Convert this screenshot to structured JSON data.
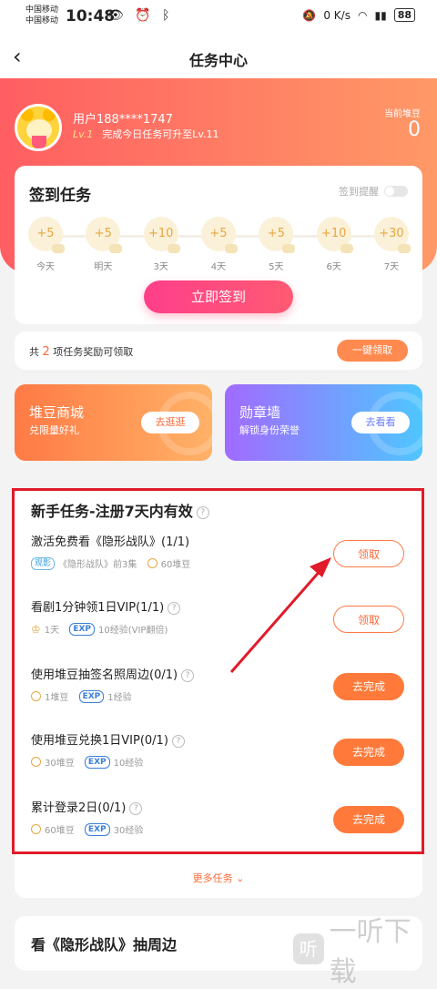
{
  "status": {
    "carrier1": "中国移动",
    "carrier2": "中国移动",
    "time": "10:48",
    "net": "0 K/s",
    "battery": "88"
  },
  "nav": {
    "title": "任务中心"
  },
  "user": {
    "name": "用户188****1747",
    "level": "Lv.1",
    "upgrade": "完成今日任务可升至Lv.11",
    "balance_label": "当前堆豆",
    "balance": "0"
  },
  "sign": {
    "title": "签到任务",
    "remind": "签到提醒",
    "days": [
      {
        "reward": "+5",
        "label": "今天"
      },
      {
        "reward": "+5",
        "label": "明天"
      },
      {
        "reward": "+10",
        "label": "3天"
      },
      {
        "reward": "+5",
        "label": "4天"
      },
      {
        "reward": "+5",
        "label": "5天"
      },
      {
        "reward": "+10",
        "label": "6天"
      },
      {
        "reward": "+30",
        "label": "7天"
      }
    ],
    "button": "立即签到"
  },
  "claim": {
    "prefix": "共",
    "count": "2",
    "suffix": "项任务奖励可领取",
    "button": "一键领取"
  },
  "promos": [
    {
      "title": "堆豆商城",
      "subtitle": "兑限量好礼",
      "button": "去逛逛"
    },
    {
      "title": "勋章墙",
      "subtitle": "解锁身份荣誉",
      "button": "去看看"
    }
  ],
  "tasks": {
    "title": "新手任务-注册7天内有效",
    "items": [
      {
        "name": "激活免费看《隐形战队》(1/1)",
        "tag": "观影",
        "m1": "《隐形战队》前3集",
        "m2": "60堆豆",
        "button": "领取"
      },
      {
        "name": "看剧1分钟领1日VIP(1/1)",
        "tag": "EXP",
        "m1": "1天",
        "m2": "10经验(VIP翻倍)",
        "button": "领取"
      },
      {
        "name": "使用堆豆抽签名照周边(0/1)",
        "tag": "EXP",
        "m1": "1堆豆",
        "m2": "1经验",
        "button": "去完成"
      },
      {
        "name": "使用堆豆兑换1日VIP(0/1)",
        "tag": "EXP",
        "m1": "30堆豆",
        "m2": "10经验",
        "button": "去完成"
      },
      {
        "name": "累计登录2日(0/1)",
        "tag": "EXP",
        "m1": "60堆豆",
        "m2": "30经验",
        "button": "去完成"
      }
    ],
    "more": "更多任务"
  },
  "next_section": {
    "title": "看《隐形战队》抽周边"
  },
  "watermark": {
    "logo": "听",
    "text": "一听下载"
  }
}
